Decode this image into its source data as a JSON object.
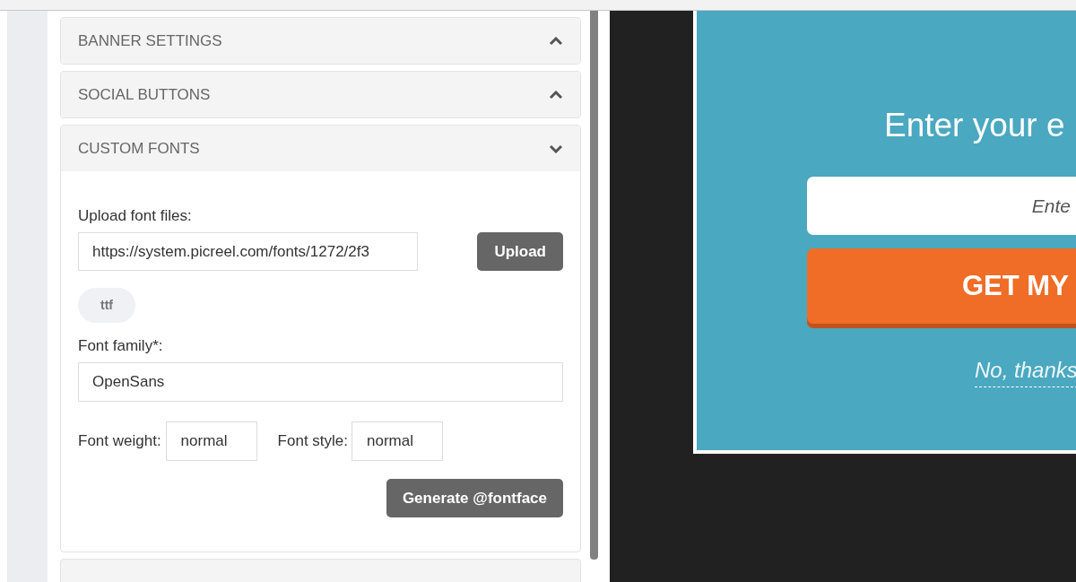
{
  "sections": [
    {
      "title": "BANNER SETTINGS",
      "expanded": false
    },
    {
      "title": "SOCIAL BUTTONS",
      "expanded": false
    },
    {
      "title": "CUSTOM FONTS",
      "expanded": true
    }
  ],
  "custom_fonts": {
    "upload_label": "Upload font files:",
    "upload_url": "https://system.picreel.com/fonts/1272/2f3",
    "upload_button": "Upload",
    "file_type": "ttf",
    "family_label": "Font family*:",
    "family_value": "OpenSans",
    "weight_label": "Font weight:",
    "weight_value": "normal",
    "style_label": "Font style:",
    "style_value": "normal",
    "generate_button": "Generate @fontface"
  },
  "preview": {
    "heading": "Enter your e",
    "email_placeholder": "Ente",
    "cta": "GET MY",
    "decline": "No, thanks"
  }
}
